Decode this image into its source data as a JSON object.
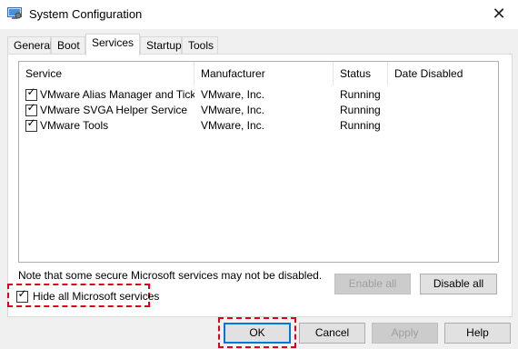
{
  "window": {
    "title": "System Configuration",
    "close_glyph": "✕",
    "icon": "msconfig-icon"
  },
  "tabs": [
    {
      "label": "General",
      "active": false
    },
    {
      "label": "Boot",
      "active": false
    },
    {
      "label": "Services",
      "active": true
    },
    {
      "label": "Startup",
      "active": false
    },
    {
      "label": "Tools",
      "active": false
    }
  ],
  "services": {
    "columns": [
      "Service",
      "Manufacturer",
      "Status",
      "Date Disabled"
    ],
    "rows": [
      {
        "checked": true,
        "service": "VMware Alias Manager and Ticke…",
        "manufacturer": "VMware, Inc.",
        "status": "Running",
        "date_disabled": ""
      },
      {
        "checked": true,
        "service": "VMware SVGA Helper Service",
        "manufacturer": "VMware, Inc.",
        "status": "Running",
        "date_disabled": ""
      },
      {
        "checked": true,
        "service": "VMware Tools",
        "manufacturer": "VMware, Inc.",
        "status": "Running",
        "date_disabled": ""
      }
    ],
    "note": "Note that some secure Microsoft services may not be disabled.",
    "enable_all": "Enable all",
    "disable_all": "Disable all",
    "hide_ms_label": "Hide all Microsoft services",
    "hide_ms_checked": true
  },
  "footer": {
    "ok": "OK",
    "cancel": "Cancel",
    "apply": "Apply",
    "help": "Help"
  },
  "colors": {
    "highlight": "#e0001b",
    "accent": "#0078d7",
    "panel": "#f0f0f0"
  },
  "tick_glyph": "✓"
}
